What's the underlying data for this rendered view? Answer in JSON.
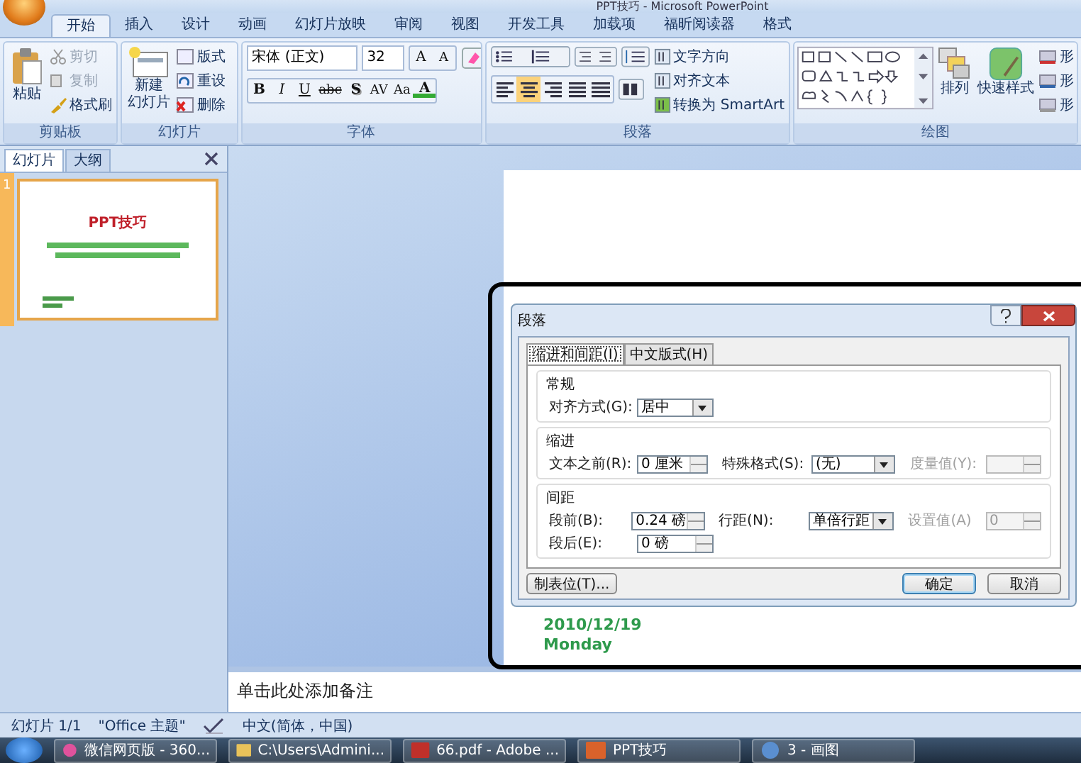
{
  "window": {
    "title": "PPT技巧 - Microsoft PowerPoint"
  },
  "ribbon_tabs": [
    {
      "label": "开始",
      "selected": true
    },
    {
      "label": "插入",
      "selected": false
    },
    {
      "label": "设计",
      "selected": false
    },
    {
      "label": "动画",
      "selected": false
    },
    {
      "label": "幻灯片放映",
      "selected": false
    },
    {
      "label": "审阅",
      "selected": false
    },
    {
      "label": "视图",
      "selected": false
    },
    {
      "label": "开发工具",
      "selected": false
    },
    {
      "label": "加载项",
      "selected": false
    },
    {
      "label": "福昕阅读器",
      "selected": false
    },
    {
      "label": "格式",
      "selected": false
    }
  ],
  "clipboard": {
    "label": "剪贴板",
    "paste": "粘贴",
    "items": [
      {
        "label": "剪切",
        "kind": "cut",
        "disabled": true
      },
      {
        "label": "复制",
        "kind": "copy",
        "disabled": true
      },
      {
        "label": "格式刷",
        "kind": "brush",
        "disabled": false
      }
    ]
  },
  "slides_group": {
    "label": "幻灯片",
    "new_slide": [
      "新建",
      "幻灯片"
    ],
    "items": [
      {
        "label": "版式",
        "kind": "layout"
      },
      {
        "label": "重设",
        "kind": "reset"
      },
      {
        "label": "删除",
        "kind": "delete"
      }
    ]
  },
  "font": {
    "label": "字体",
    "face": "宋体 (正文)",
    "size": "32",
    "size_buttons": [
      {
        "label": "A",
        "kind": "grow"
      },
      {
        "label": "A",
        "kind": "shrink"
      }
    ],
    "buttons": [
      {
        "label": "B",
        "kind": "bold"
      },
      {
        "label": "I",
        "kind": "italic"
      },
      {
        "label": "U",
        "kind": "underline"
      },
      {
        "label": "abc",
        "kind": "strike"
      },
      {
        "label": "S",
        "kind": "shadow"
      },
      {
        "label": "AV",
        "kind": "spacing"
      },
      {
        "label": "Aa",
        "kind": "case"
      },
      {
        "label": "A",
        "kind": "color"
      }
    ]
  },
  "paragraph": {
    "label": "段落",
    "alignment": [
      {
        "kind": "left",
        "selected": false
      },
      {
        "kind": "center",
        "selected": true
      },
      {
        "kind": "right",
        "selected": false
      },
      {
        "kind": "justify",
        "selected": false
      },
      {
        "kind": "distributed",
        "selected": false
      }
    ],
    "commands": [
      {
        "label": "文字方向",
        "kind": "direction"
      },
      {
        "label": "对齐文本",
        "kind": "align"
      },
      {
        "label": "转换为 SmartArt",
        "kind": "smartart"
      }
    ]
  },
  "drawing": {
    "label": "绘图",
    "arrange": "排列",
    "quick_styles": "快速样式",
    "shape_commands": [
      {
        "label": "形",
        "kind": "fill"
      },
      {
        "label": "形",
        "kind": "outline"
      },
      {
        "label": "形",
        "kind": "effect"
      }
    ]
  },
  "side_pane": {
    "tabs": [
      {
        "label": "幻灯片",
        "selected": true
      },
      {
        "label": "大纲",
        "selected": false
      }
    ],
    "thumbnails": [
      {
        "number": "1",
        "title": "PPT技巧",
        "selected": true
      }
    ]
  },
  "slide": {
    "texts": [
      "2010/12/19",
      "Monday"
    ]
  },
  "notes": {
    "placeholder": "单击此处添加备注"
  },
  "dialog": {
    "title": "段落",
    "tabs": [
      {
        "label": "缩进和间距(I)",
        "selected": true
      },
      {
        "label": "中文版式(H)",
        "selected": false
      }
    ],
    "general": {
      "title": "常规",
      "alignment": {
        "label": "对齐方式(G):",
        "value": "居中"
      }
    },
    "indent": {
      "title": "缩进",
      "before_text": {
        "label": "文本之前(R):",
        "value": "0 厘米"
      },
      "special": {
        "label": "特殊格式(S):",
        "value": "(无)"
      },
      "by": {
        "label": "度量值(Y):",
        "disabled": true
      }
    },
    "spacing": {
      "title": "间距",
      "before": {
        "label": "段前(B):",
        "value": "0.24 磅"
      },
      "line_spacing": {
        "label": "行距(N):",
        "value": "单倍行距"
      },
      "at": {
        "label": "设置值(A)",
        "value": "0",
        "disabled": true
      },
      "after": {
        "label": "段后(E):",
        "value": "0 磅"
      }
    },
    "tabs_button": "制表位(T)...",
    "ok": "确定",
    "cancel": "取消"
  },
  "status_bar": {
    "slide": "幻灯片 1/1",
    "theme": "\"Office 主题\"",
    "language": "中文(简体，中国)"
  },
  "taskbar": {
    "items": [
      {
        "label": "微信网页版 - 360...",
        "kind": "browser"
      },
      {
        "label": "C:\\Users\\Admini...",
        "kind": "folder"
      },
      {
        "label": "66.pdf - Adobe ...",
        "kind": "pdf"
      },
      {
        "label": "PPT技巧",
        "kind": "powerpoint"
      },
      {
        "label": "3 - 画图",
        "kind": "paint"
      }
    ]
  }
}
